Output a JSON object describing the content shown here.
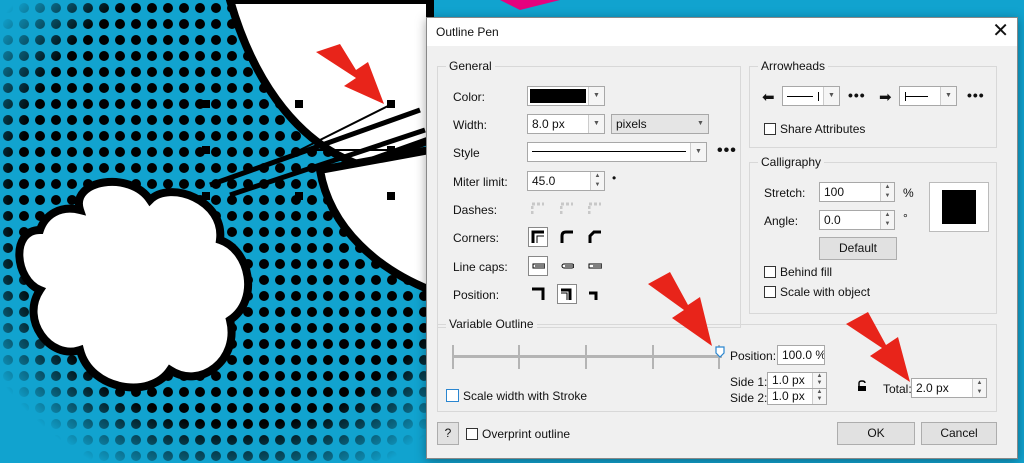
{
  "dialog": {
    "title": "Outline Pen",
    "close_glyph": "✕"
  },
  "general": {
    "title": "General",
    "color_label": "Color:",
    "color_value": "#000000",
    "width_label": "Width:",
    "width_value": "8.0 px",
    "units_value": "pixels",
    "style_label": "Style",
    "miter_label": "Miter limit:",
    "miter_value": "45.0",
    "dashes_label": "Dashes:",
    "corners_label": "Corners:",
    "linecaps_label": "Line caps:",
    "position_label": "Position:"
  },
  "arrowheads": {
    "title": "Arrowheads",
    "share_label": "Share Attributes",
    "share_checked": false
  },
  "calligraphy": {
    "title": "Calligraphy",
    "stretch_label": "Stretch:",
    "stretch_value": "100",
    "stretch_unit": "%",
    "angle_label": "Angle:",
    "angle_value": "0.0",
    "angle_unit": "°",
    "default_label": "Default",
    "behind_fill_label": "Behind fill",
    "scale_with_object_label": "Scale with object"
  },
  "variable_outline": {
    "title": "Variable Outline",
    "position_label": "Position:",
    "position_value": "100.0 %",
    "side1_label": "Side 1:",
    "side1_value": "1.0 px",
    "side2_label": "Side 2:",
    "side2_value": "1.0 px",
    "total_label": "Total:",
    "total_value": "2.0 px",
    "scale_width_label": "Scale width with Stroke",
    "slider_position": 1.0
  },
  "footer": {
    "help_label": "?",
    "overprint_label": "Overprint outline",
    "ok_label": "OK",
    "cancel_label": "Cancel"
  },
  "colors": {
    "canvas_bg": "#11a3cf",
    "annotation_arrow": "#e8241a"
  }
}
